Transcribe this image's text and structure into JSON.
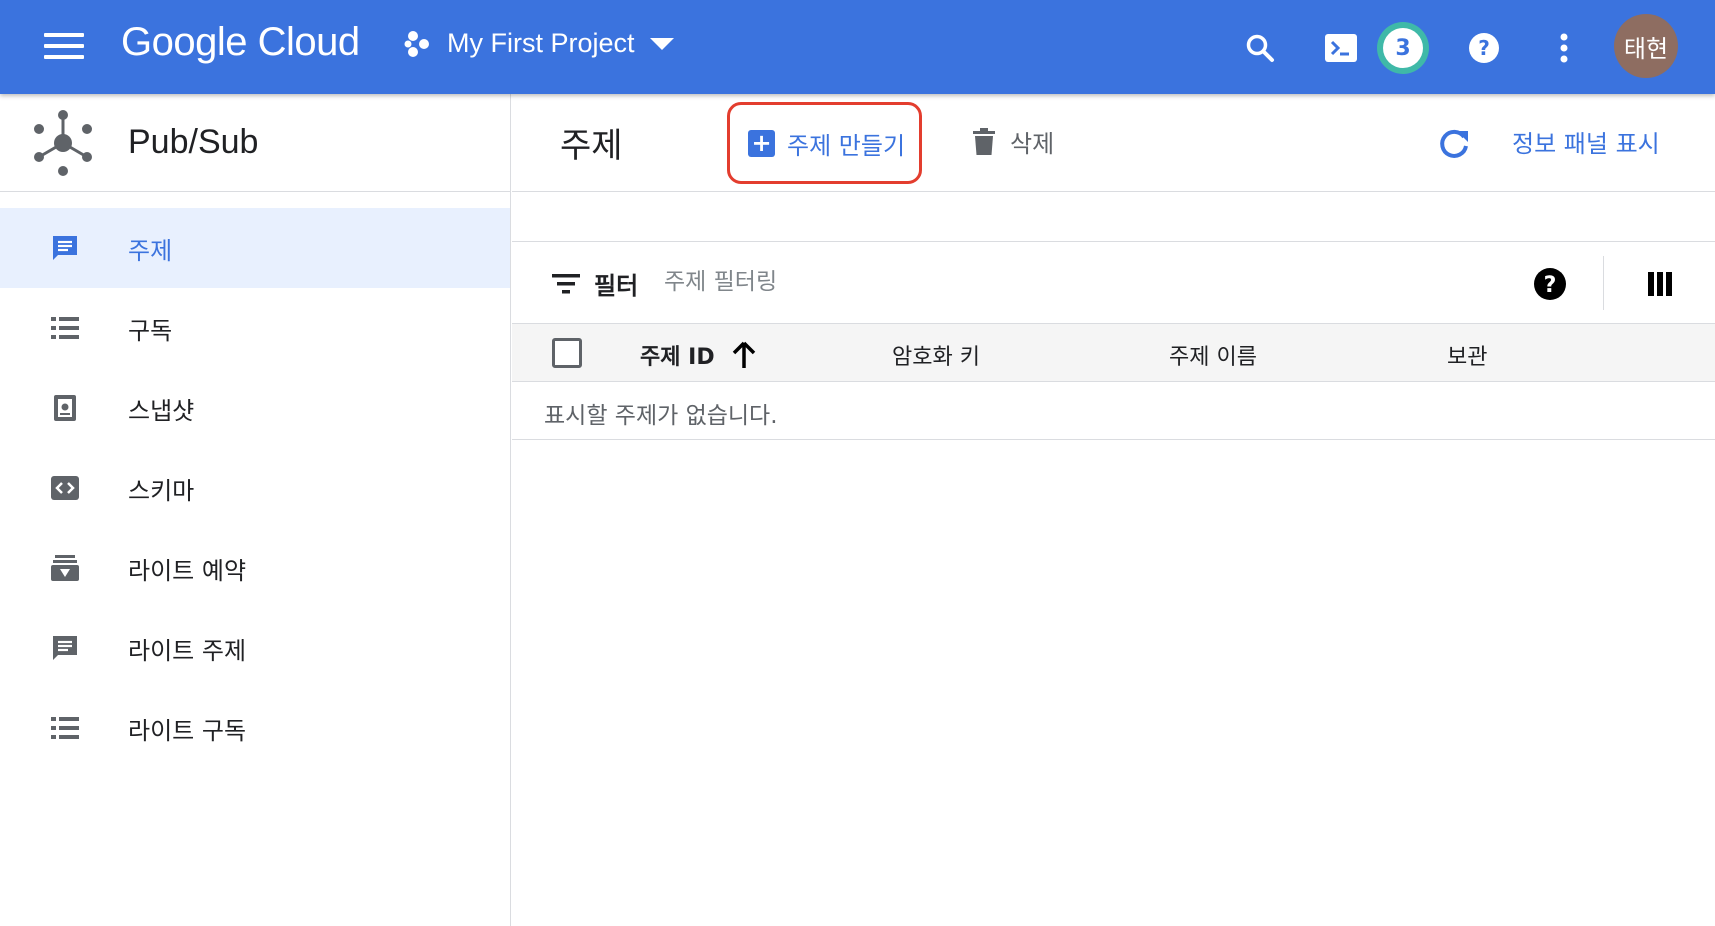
{
  "topbar": {
    "brand": "Google Cloud",
    "project_name": "My First Project",
    "notification_count": "3",
    "avatar_text": "태현",
    "color": "#3b73de"
  },
  "sidebar": {
    "product_name": "Pub/Sub",
    "items": [
      {
        "label": "주제",
        "icon": "message-icon",
        "active": true
      },
      {
        "label": "구독",
        "icon": "list-icon"
      },
      {
        "label": "스냅샷",
        "icon": "snapshot-icon"
      },
      {
        "label": "스키마",
        "icon": "code-icon"
      },
      {
        "label": "라이트 예약",
        "icon": "reservation-icon"
      },
      {
        "label": "라이트 주제",
        "icon": "message-icon"
      },
      {
        "label": "라이트 구독",
        "icon": "list-icon"
      }
    ]
  },
  "main": {
    "title": "주제",
    "create_label": "주제 만들기",
    "delete_label": "삭제",
    "info_panel_label": "정보 패널 표시",
    "filter_label": "필터",
    "filter_placeholder": "주제 필터링",
    "columns": {
      "topic_id": "주제 ID",
      "encryption_key": "암호화 키",
      "topic_name": "주제 이름",
      "retention": "보관"
    },
    "empty_message": "표시할 주제가 없습니다."
  }
}
